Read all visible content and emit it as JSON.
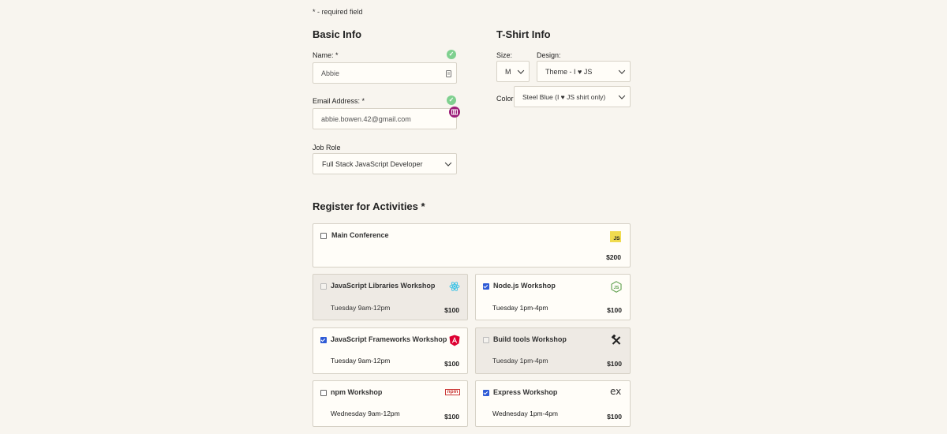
{
  "required_note": "* - required field",
  "basic_info": {
    "heading": "Basic Info",
    "name_label": "Name: *",
    "name_value": "Abbie",
    "email_label": "Email Address: *",
    "email_value": "abbie.bowen.42@gmail.com",
    "job_role_label": "Job Role",
    "job_role_value": "Full Stack JavaScript Developer"
  },
  "tshirt_info": {
    "heading": "T-Shirt Info",
    "size_label": "Size:",
    "size_value": "M",
    "design_label": "Design:",
    "design_value": "Theme - I ♥ JS",
    "color_label": "Color:",
    "color_value": "Steel Blue (I ♥ JS shirt only)"
  },
  "activities": {
    "heading": "Register for Activities *",
    "main": {
      "title": "Main Conference",
      "price": "$200",
      "icon": "js-logo-icon",
      "checked": false
    },
    "items": [
      {
        "title": "JavaScript Libraries Workshop",
        "time": "Tuesday 9am-12pm",
        "price": "$100",
        "icon": "react-icon",
        "checked": false,
        "disabled": true
      },
      {
        "title": "Node.js Workshop",
        "time": "Tuesday 1pm-4pm",
        "price": "$100",
        "icon": "nodejs-icon",
        "checked": true,
        "disabled": false
      },
      {
        "title": "JavaScript Frameworks Workshop",
        "time": "Tuesday 9am-12pm",
        "price": "$100",
        "icon": "angular-icon",
        "checked": true,
        "disabled": false
      },
      {
        "title": "Build tools Workshop",
        "time": "Tuesday 1pm-4pm",
        "price": "$100",
        "icon": "tools-icon",
        "checked": false,
        "disabled": true
      },
      {
        "title": "npm Workshop",
        "time": "Wednesday 9am-12pm",
        "price": "$100",
        "icon": "npm-icon",
        "checked": false,
        "disabled": false
      },
      {
        "title": "Express Workshop",
        "time": "Wednesday 1pm-4pm",
        "price": "$100",
        "icon": "express-icon",
        "checked": true,
        "disabled": false
      }
    ]
  },
  "icons": {
    "js_logo_text": "JS",
    "npm_text": "npm",
    "express_text": "ex"
  },
  "colors": {
    "valid_green": "#7fd08f",
    "checkbox_blue": "#2f5bd6",
    "js_yellow": "#f0db4f",
    "angular_red": "#dd0031",
    "npm_red": "#cb3837"
  }
}
